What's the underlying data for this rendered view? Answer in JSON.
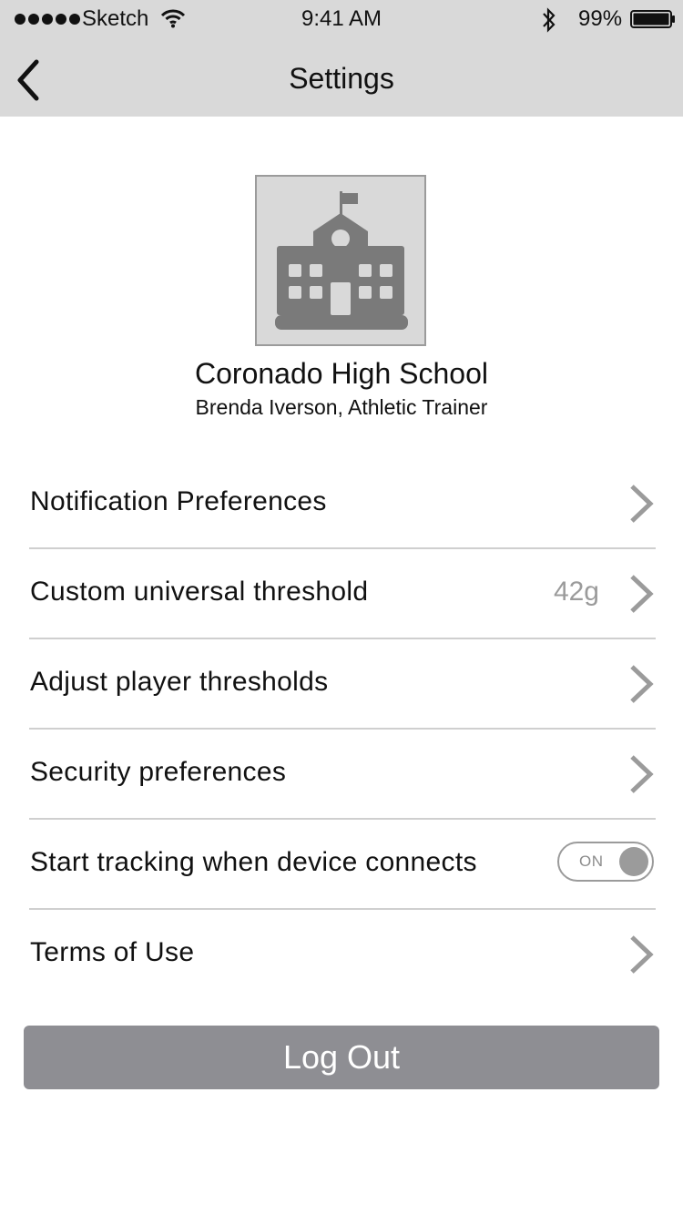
{
  "status_bar": {
    "carrier": "Sketch",
    "time": "9:41 AM",
    "battery_percent": "99%"
  },
  "nav": {
    "title": "Settings"
  },
  "profile": {
    "school_name": "Coronado High School",
    "user_role": "Brenda Iverson, Athletic Trainer",
    "avatar_icon": "school-building-icon"
  },
  "settings": [
    {
      "label": "Notification Preferences",
      "value": "",
      "control": "chevron"
    },
    {
      "label": "Custom universal threshold",
      "value": "42g",
      "control": "chevron"
    },
    {
      "label": "Adjust player thresholds",
      "value": "",
      "control": "chevron"
    },
    {
      "label": "Security preferences",
      "value": "",
      "control": "chevron"
    },
    {
      "label": "Start tracking when device connects",
      "value": "",
      "control": "toggle",
      "toggle_text": "ON"
    },
    {
      "label": "Terms of Use",
      "value": "",
      "control": "chevron"
    }
  ],
  "logout_label": "Log Out",
  "colors": {
    "topbar_bg": "#d9d9d9",
    "accent_gray": "#9b9b9b",
    "button_bg": "#8e8e93"
  }
}
